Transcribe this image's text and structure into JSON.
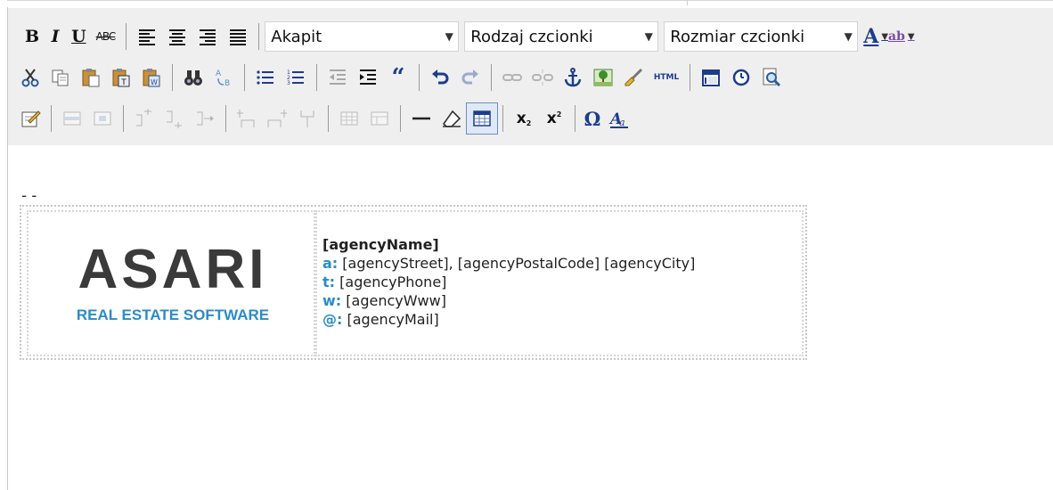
{
  "colors": {
    "toolbar_bg": "#efefef",
    "accent_blue": "#2a8cc8",
    "logo_gray": "#3a3a3a"
  },
  "toolbar": {
    "format": {
      "bold": "B",
      "italic": "I",
      "underline": "U",
      "strike": "ABC"
    },
    "paragraph_select": "Akapit",
    "font_select": "Rodzaj czcionki",
    "size_select": "Rozmiar czcionki",
    "font_color_glyph": "A",
    "highlight_glyph": "ab",
    "html_label": "HTML",
    "subscript_label": "x",
    "superscript_label": "x",
    "omega": "Ω"
  },
  "editor": {
    "separator": "--",
    "logo": {
      "main": "ASARI",
      "sub": "REAL ESTATE SOFTWARE"
    },
    "info": {
      "name": "[agencyName]",
      "address_key": "a:",
      "address": "[agencyStreet], [agencyPostalCode] [agencyCity]",
      "phone_key": "t:",
      "phone": "[agencyPhone]",
      "www_key": "w:",
      "www": "[agencyWww]",
      "mail_key": "@:",
      "mail": "[agencyMail]"
    }
  }
}
